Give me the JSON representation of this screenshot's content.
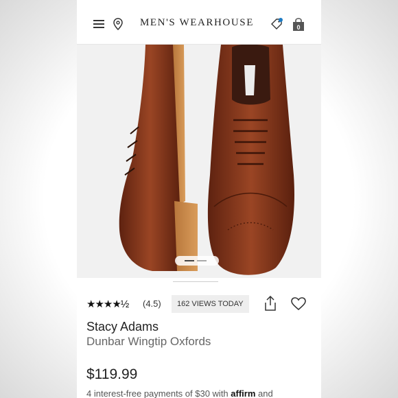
{
  "header": {
    "brand": "MEN'S WEARHOUSE",
    "bag_count": "0"
  },
  "icons": {
    "menu": "hamburger-icon",
    "location": "location-pin-icon",
    "promo": "tag-icon",
    "bag": "shopping-bag-icon",
    "share": "share-icon",
    "wishlist": "heart-icon"
  },
  "colors": {
    "promo_dot": "#1c7bc4",
    "shoe_leather": "#8a3a1c"
  },
  "product": {
    "stars": "★★★★½",
    "rating": 4.5,
    "rating_label": "(4.5)",
    "views": "162 VIEWS TODAY",
    "brand": "Stacy Adams",
    "name": "Dunbar Wingtip Oxfords",
    "price": "$119.99",
    "installments_prefix": "4 interest-free payments of $30 with",
    "installments_affirm": "affirm",
    "installments_suffix": "and"
  },
  "gallery": {
    "image": "shoe-pair-image",
    "current_slide": 1,
    "slide_count": 2
  }
}
